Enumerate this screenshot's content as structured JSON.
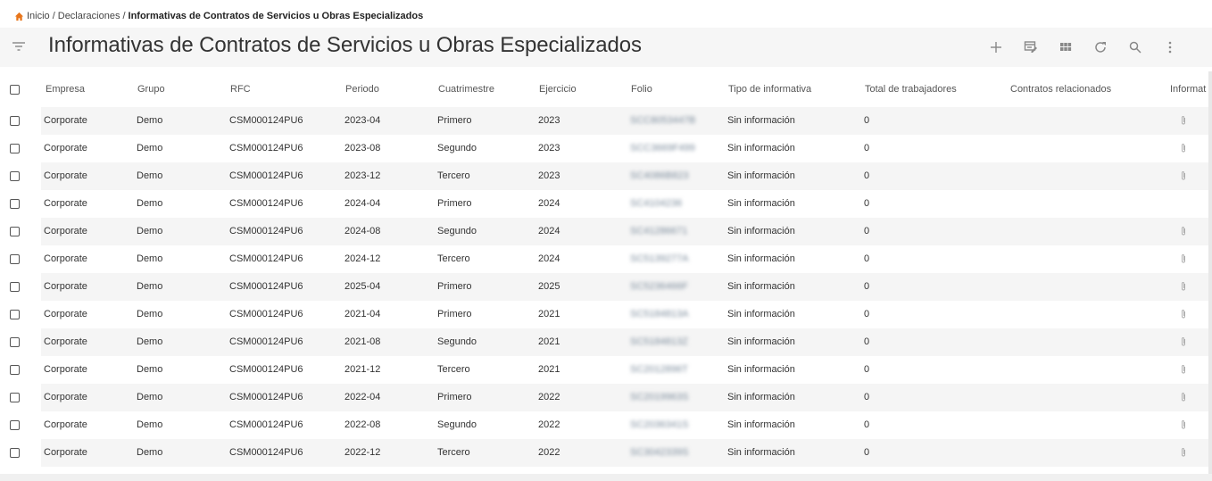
{
  "breadcrumb": {
    "home": "Inicio",
    "section": "Declaraciones",
    "current": "Informativas de Contratos de Servicios u Obras Especializados"
  },
  "page_title": "Informativas de Contratos de Servicios u Obras Especializados",
  "toolbar": [
    "add-icon",
    "edit-columns-icon",
    "grid-view-icon",
    "refresh-icon",
    "search-icon",
    "more-vert-icon"
  ],
  "colors": {
    "home_icon": "#e8751a",
    "header_bg": "#f6f6f6",
    "alt_row": "#f5f5f5"
  },
  "columns": [
    "Empresa",
    "Grupo",
    "RFC",
    "Periodo",
    "Cuatrimestre",
    "Ejercicio",
    "Folio",
    "Tipo de informativa",
    "Total de trabajadores",
    "Contratos relacionados",
    "Informat"
  ],
  "rows": [
    {
      "empresa": "Corporate",
      "grupo": "Demo",
      "rfc": "CSM000124PU6",
      "periodo": "2023-04",
      "cuatrimestre": "Primero",
      "ejercicio": "2023",
      "folio": "SCC8053447B",
      "tipo": "Sin información",
      "total": "0",
      "attach": true
    },
    {
      "empresa": "Corporate",
      "grupo": "Demo",
      "rfc": "CSM000124PU6",
      "periodo": "2023-08",
      "cuatrimestre": "Segundo",
      "ejercicio": "2023",
      "folio": "SCC3669F499",
      "tipo": "Sin información",
      "total": "0",
      "attach": true
    },
    {
      "empresa": "Corporate",
      "grupo": "Demo",
      "rfc": "CSM000124PU6",
      "periodo": "2023-12",
      "cuatrimestre": "Tercero",
      "ejercicio": "2023",
      "folio": "SC4086B823",
      "tipo": "Sin información",
      "total": "0",
      "attach": true
    },
    {
      "empresa": "Corporate",
      "grupo": "Demo",
      "rfc": "CSM000124PU6",
      "periodo": "2024-04",
      "cuatrimestre": "Primero",
      "ejercicio": "2024",
      "folio": "SC4104236",
      "tipo": "Sin información",
      "total": "0",
      "attach": false
    },
    {
      "empresa": "Corporate",
      "grupo": "Demo",
      "rfc": "CSM000124PU6",
      "periodo": "2024-08",
      "cuatrimestre": "Segundo",
      "ejercicio": "2024",
      "folio": "SC41286671",
      "tipo": "Sin información",
      "total": "0",
      "attach": true
    },
    {
      "empresa": "Corporate",
      "grupo": "Demo",
      "rfc": "CSM000124PU6",
      "periodo": "2024-12",
      "cuatrimestre": "Tercero",
      "ejercicio": "2024",
      "folio": "SC5139277A",
      "tipo": "Sin información",
      "total": "0",
      "attach": true
    },
    {
      "empresa": "Corporate",
      "grupo": "Demo",
      "rfc": "CSM000124PU6",
      "periodo": "2025-04",
      "cuatrimestre": "Primero",
      "ejercicio": "2025",
      "folio": "SC5236466F",
      "tipo": "Sin información",
      "total": "0",
      "attach": true
    },
    {
      "empresa": "Corporate",
      "grupo": "Demo",
      "rfc": "CSM000124PU6",
      "periodo": "2021-04",
      "cuatrimestre": "Primero",
      "ejercicio": "2021",
      "folio": "SC5184813A",
      "tipo": "Sin información",
      "total": "0",
      "attach": true
    },
    {
      "empresa": "Corporate",
      "grupo": "Demo",
      "rfc": "CSM000124PU6",
      "periodo": "2021-08",
      "cuatrimestre": "Segundo",
      "ejercicio": "2021",
      "folio": "SC5184813Z",
      "tipo": "Sin información",
      "total": "0",
      "attach": true
    },
    {
      "empresa": "Corporate",
      "grupo": "Demo",
      "rfc": "CSM000124PU6",
      "periodo": "2021-12",
      "cuatrimestre": "Tercero",
      "ejercicio": "2021",
      "folio": "SC2012896T",
      "tipo": "Sin información",
      "total": "0",
      "attach": true
    },
    {
      "empresa": "Corporate",
      "grupo": "Demo",
      "rfc": "CSM000124PU6",
      "periodo": "2022-04",
      "cuatrimestre": "Primero",
      "ejercicio": "2022",
      "folio": "SC2019963S",
      "tipo": "Sin información",
      "total": "0",
      "attach": true
    },
    {
      "empresa": "Corporate",
      "grupo": "Demo",
      "rfc": "CSM000124PU6",
      "periodo": "2022-08",
      "cuatrimestre": "Segundo",
      "ejercicio": "2022",
      "folio": "SC2036341S",
      "tipo": "Sin información",
      "total": "0",
      "attach": true
    },
    {
      "empresa": "Corporate",
      "grupo": "Demo",
      "rfc": "CSM000124PU6",
      "periodo": "2022-12",
      "cuatrimestre": "Tercero",
      "ejercicio": "2022",
      "folio": "SC3042339S",
      "tipo": "Sin información",
      "total": "0",
      "attach": true
    }
  ]
}
